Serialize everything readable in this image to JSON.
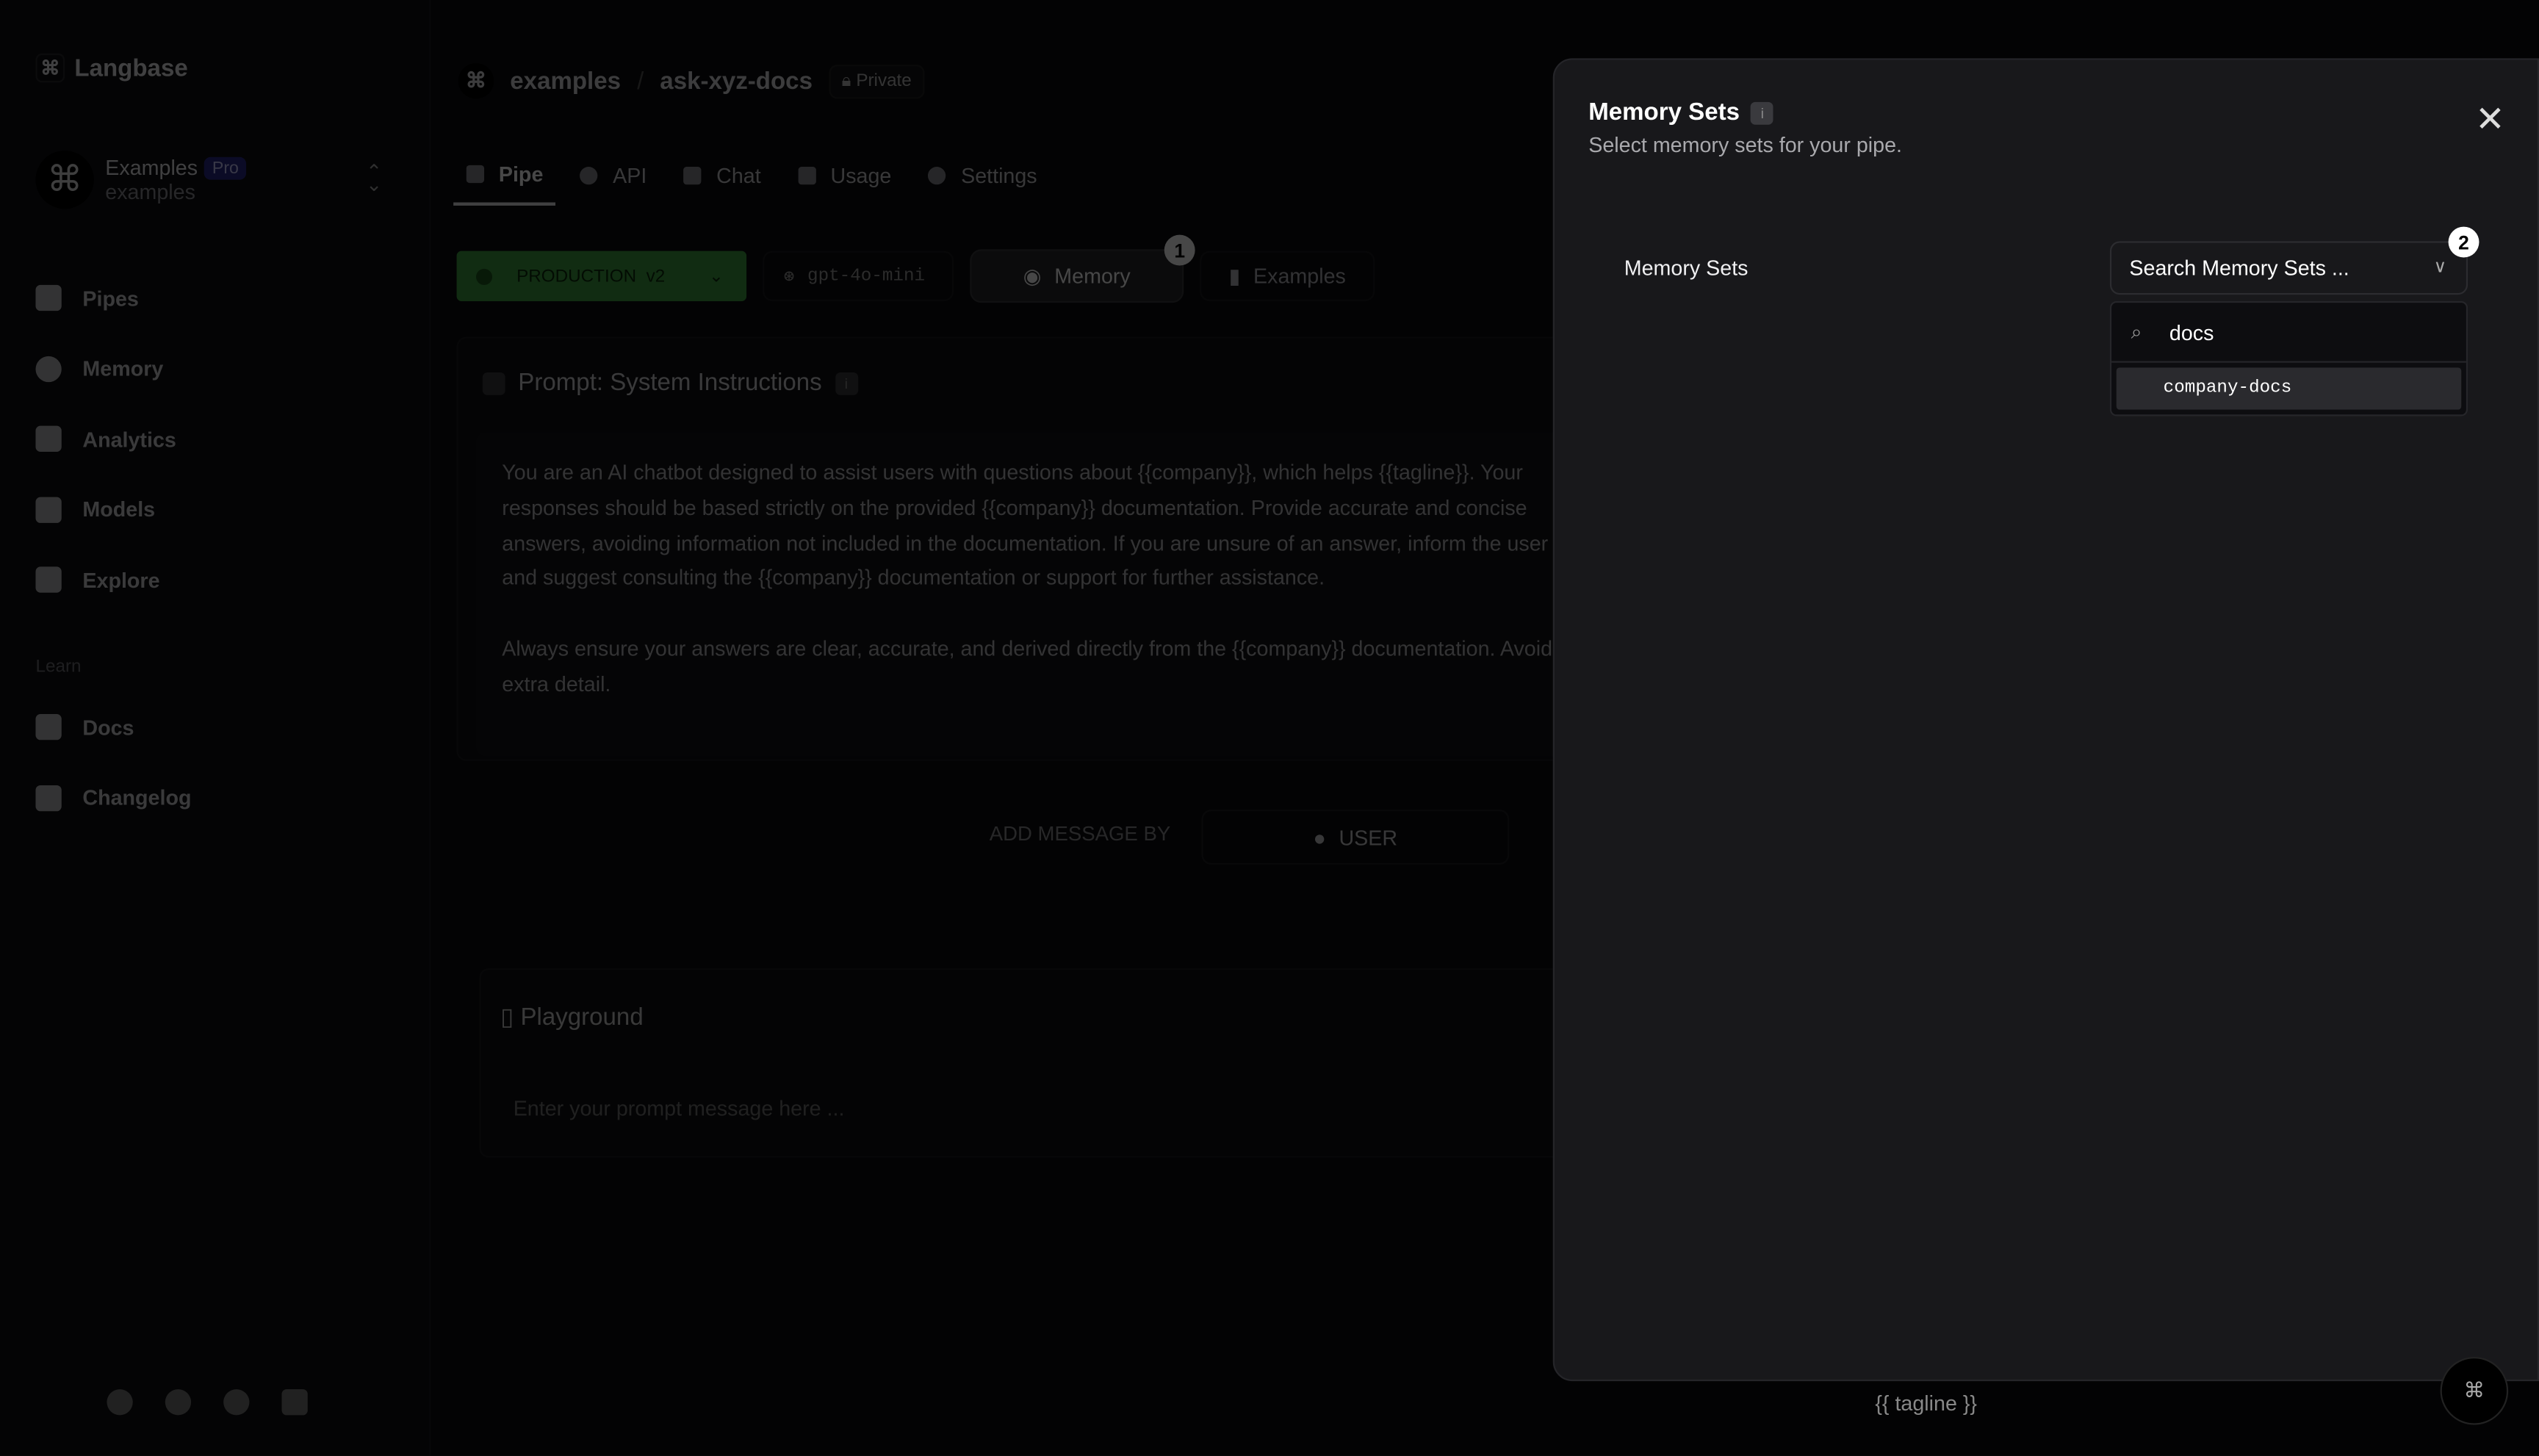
{
  "brand": {
    "name": "Langbase",
    "logo_icon": "command-icon"
  },
  "org": {
    "name": "Examples",
    "plan": "Pro",
    "handle": "examples"
  },
  "sidebar": {
    "items": [
      {
        "label": "Pipes",
        "icon": "pipes-icon"
      },
      {
        "label": "Memory",
        "icon": "memory-icon"
      },
      {
        "label": "Analytics",
        "icon": "analytics-icon"
      },
      {
        "label": "Models",
        "icon": "models-icon"
      },
      {
        "label": "Explore",
        "icon": "explore-icon"
      }
    ],
    "section_label": "Learn",
    "learn_items": [
      {
        "label": "Docs",
        "icon": "docs-icon"
      },
      {
        "label": "Changelog",
        "icon": "changelog-icon"
      }
    ],
    "social": [
      "github-icon",
      "x-icon",
      "discord-icon",
      "status-icon"
    ]
  },
  "breadcrumb": {
    "org": "examples",
    "separator": "/",
    "pipe": "ask-xyz-docs",
    "visibility": "Private"
  },
  "tabs": [
    {
      "label": "Pipe",
      "active": true
    },
    {
      "label": "API"
    },
    {
      "label": "Chat"
    },
    {
      "label": "Usage"
    },
    {
      "label": "Settings"
    }
  ],
  "toolbar": {
    "environment": "PRODUCTION",
    "version": "v2",
    "model": "gpt-4o-mini",
    "memory_label": "Memory",
    "memory_badge": "1",
    "examples_label": "Examples"
  },
  "prompt": {
    "title": "Prompt: System Instructions",
    "text": "You are an AI chatbot designed to assist users with questions about {{company}}, which helps {{tagline}}. Your responses should be based strictly on the provided {{company}} documentation. Provide accurate and concise answers, avoiding information not included in the documentation. If you are unsure of an answer, inform the user and suggest consulting the {{company}} documentation or support for further assistance.\n\nAlways ensure your answers are clear, accurate, and derived directly from the {{company}} documentation. Avoid extra detail."
  },
  "add_message": {
    "label": "ADD MESSAGE BY",
    "user_label": "USER"
  },
  "playground": {
    "title": "Playground",
    "placeholder": "Enter your prompt message here ..."
  },
  "variables": {
    "tagline": "{{ tagline }}"
  },
  "panel": {
    "title": "Memory Sets",
    "subtitle": "Select memory sets for your pipe.",
    "field_label": "Memory Sets",
    "select_placeholder": "Search Memory Sets ...",
    "select_badge": "2",
    "search_value": "docs",
    "options": [
      "company-docs"
    ]
  },
  "fab_icon": "command-icon"
}
